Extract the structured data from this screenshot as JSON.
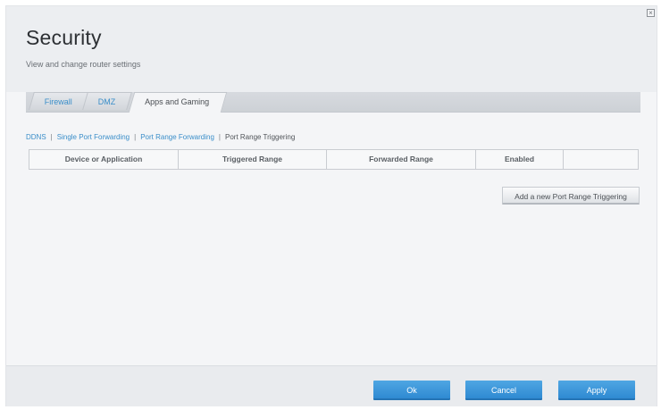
{
  "header": {
    "title": "Security",
    "subtitle": "View and change router settings",
    "close_glyph": "×"
  },
  "tabs": [
    {
      "label": "Firewall",
      "active": false
    },
    {
      "label": "DMZ",
      "active": false
    },
    {
      "label": "Apps and Gaming",
      "active": true
    }
  ],
  "subnav": [
    {
      "label": "DDNS",
      "current": false
    },
    {
      "label": "Single Port Forwarding",
      "current": false
    },
    {
      "label": "Port Range Forwarding",
      "current": false
    },
    {
      "label": "Port Range Triggering",
      "current": true
    }
  ],
  "table": {
    "columns": [
      "Device or Application",
      "Triggered Range",
      "Forwarded Range",
      "Enabled",
      ""
    ]
  },
  "actions": {
    "add_label": "Add a new Port Range Triggering"
  },
  "footer": {
    "ok_label": "Ok",
    "cancel_label": "Cancel",
    "apply_label": "Apply"
  },
  "colors": {
    "accent": "#3a8ec9",
    "button_blue": "#3d97da"
  }
}
